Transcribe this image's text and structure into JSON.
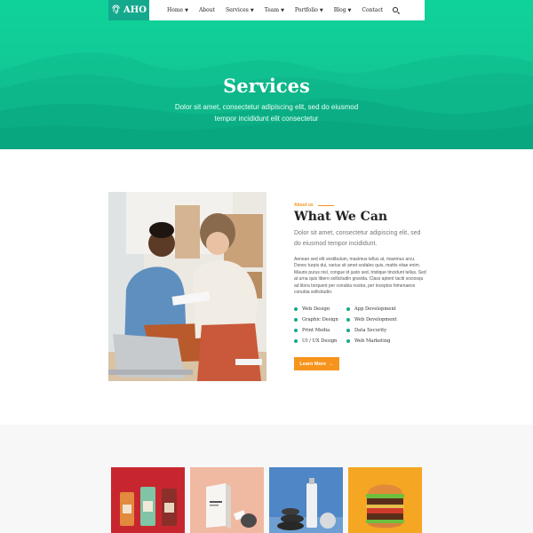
{
  "nav": {
    "logo_text": "AHO",
    "items": [
      {
        "label": "Home",
        "dropdown": true
      },
      {
        "label": "About",
        "dropdown": false
      },
      {
        "label": "Services",
        "dropdown": true
      },
      {
        "label": "Team",
        "dropdown": true
      },
      {
        "label": "Portfolio",
        "dropdown": true
      },
      {
        "label": "Blog",
        "dropdown": true
      },
      {
        "label": "Contact",
        "dropdown": false
      }
    ],
    "search_icon": "search-icon"
  },
  "hero": {
    "title": "Services",
    "subtitle": "Dolor sit amet, consectetur adipiscing elit, sed do eiusmod tempor incididunt elit consectetur"
  },
  "about": {
    "eyebrow": "About us",
    "title": "What We Can",
    "lead": "Dolor sit amet, consectetur adipiscing elit, sed do eiusmod tempor incididunt.",
    "body": "Aenean sed elit vestibulum, maximus tellus at, maximus arcu. Donec turpis dui, varius sit amet sodales quis, mattis vitae enim. Mauris purus nisl, congue id justo sed, tristique tincidunt tellus. Sed at urna quis libero sollicitudin gravida. Class aptent taciti sociosqu ad litora torquent per conubia nostra, per inceptos himenaeos conubia sollicitudin.",
    "services": [
      "Web Design",
      "App Development",
      "Graphic Design",
      "Web Development",
      "Print Media",
      "Data Security",
      "UI / UX Design",
      "Web Marketing"
    ],
    "button_label": "Learn More",
    "button_arrow": "→"
  },
  "colors": {
    "brand_green": "#14a98d",
    "hero_green": "#12c995",
    "accent_orange": "#f7941d"
  }
}
